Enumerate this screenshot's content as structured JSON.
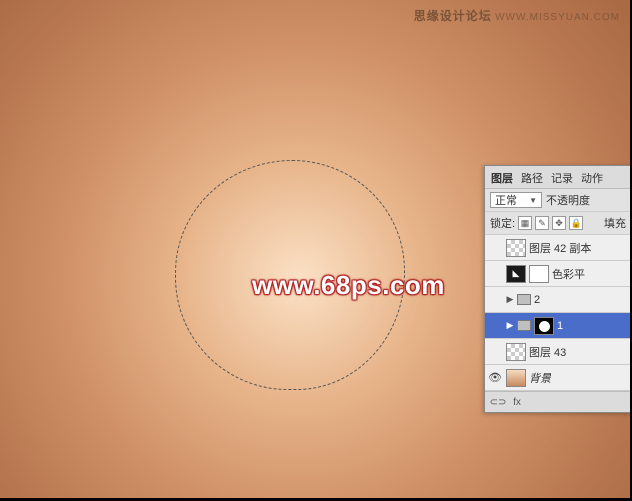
{
  "watermark": {
    "top_bold": "思缘设计论坛",
    "top_thin": "WWW.MISSYUAN.COM",
    "center": "www.68ps.com"
  },
  "panel": {
    "tabs": {
      "layers": "图层",
      "paths": "路径",
      "history": "记录",
      "actions": "动作"
    },
    "blend_mode": "正常",
    "opacity_label": "不透明度",
    "lock_label": "锁定:",
    "fill_label": "填充",
    "layers": [
      {
        "name": "图层 42 副本"
      },
      {
        "name": "色彩平"
      },
      {
        "name": "2"
      },
      {
        "name": "1"
      },
      {
        "name": "图层 43"
      },
      {
        "name": "背景"
      }
    ],
    "footer_glyphs": {
      "link": "⊂⊃",
      "fx": "fx"
    }
  }
}
